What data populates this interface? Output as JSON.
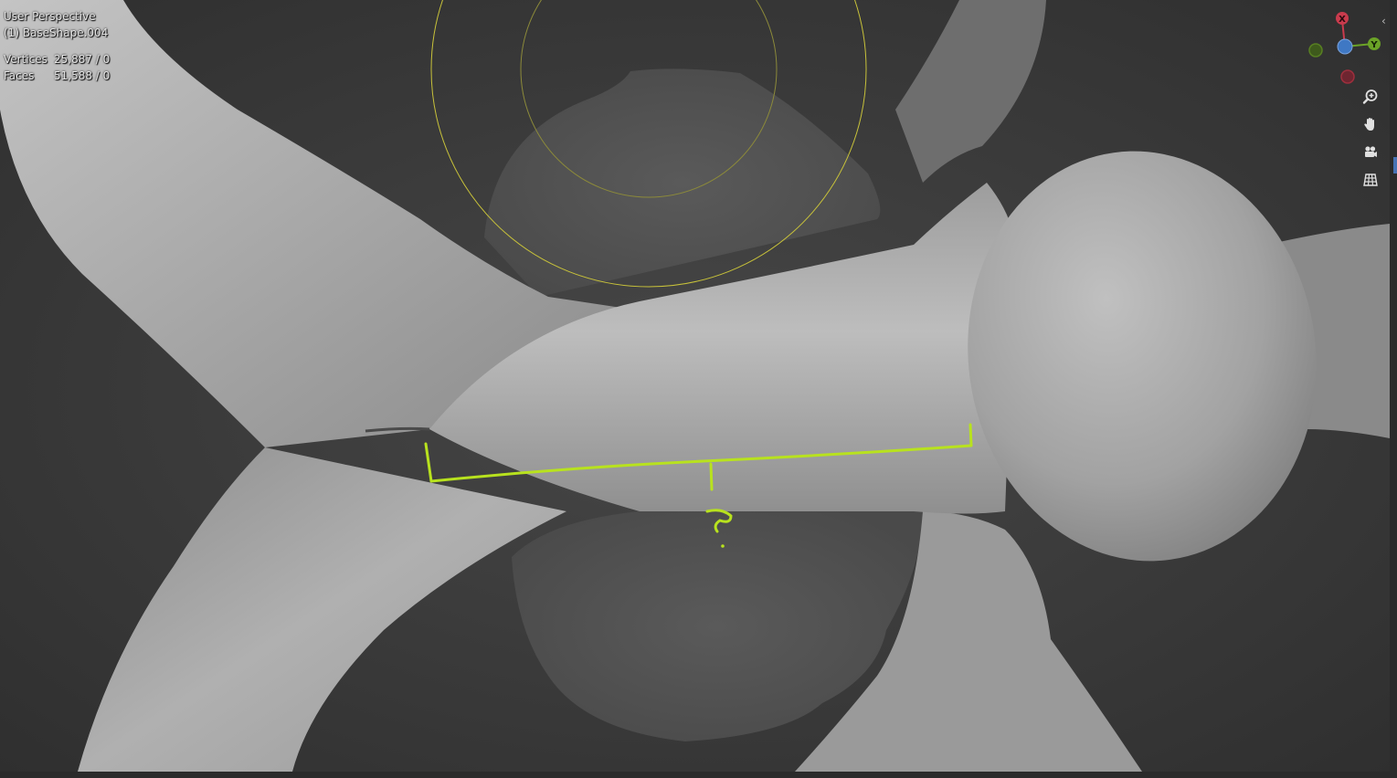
{
  "viewport": {
    "view_name": "User Perspective",
    "object_name": "(1) BaseShape.004"
  },
  "stats": {
    "vertices_label": "Vertices",
    "vertices_value": "25,887 / 0",
    "faces_label": "Faces",
    "faces_value": "51,588 / 0"
  },
  "gizmo": {
    "x_label": "X",
    "y_label": "Y",
    "x_color": "#c93b4d",
    "y_color": "#6ba327",
    "z_color": "#3f78c4",
    "neg_x_color": "#9e2f3d",
    "neg_y_color": "#587f22"
  },
  "nav_buttons": {
    "zoom": "zoom-icon",
    "pan": "hand-icon",
    "camera": "camera-icon",
    "ortho": "grid-icon"
  },
  "annotation": {
    "color": "#b8e21e",
    "text": "?"
  },
  "brush_color": "#c8c23a",
  "collapse_glyph": "‹"
}
